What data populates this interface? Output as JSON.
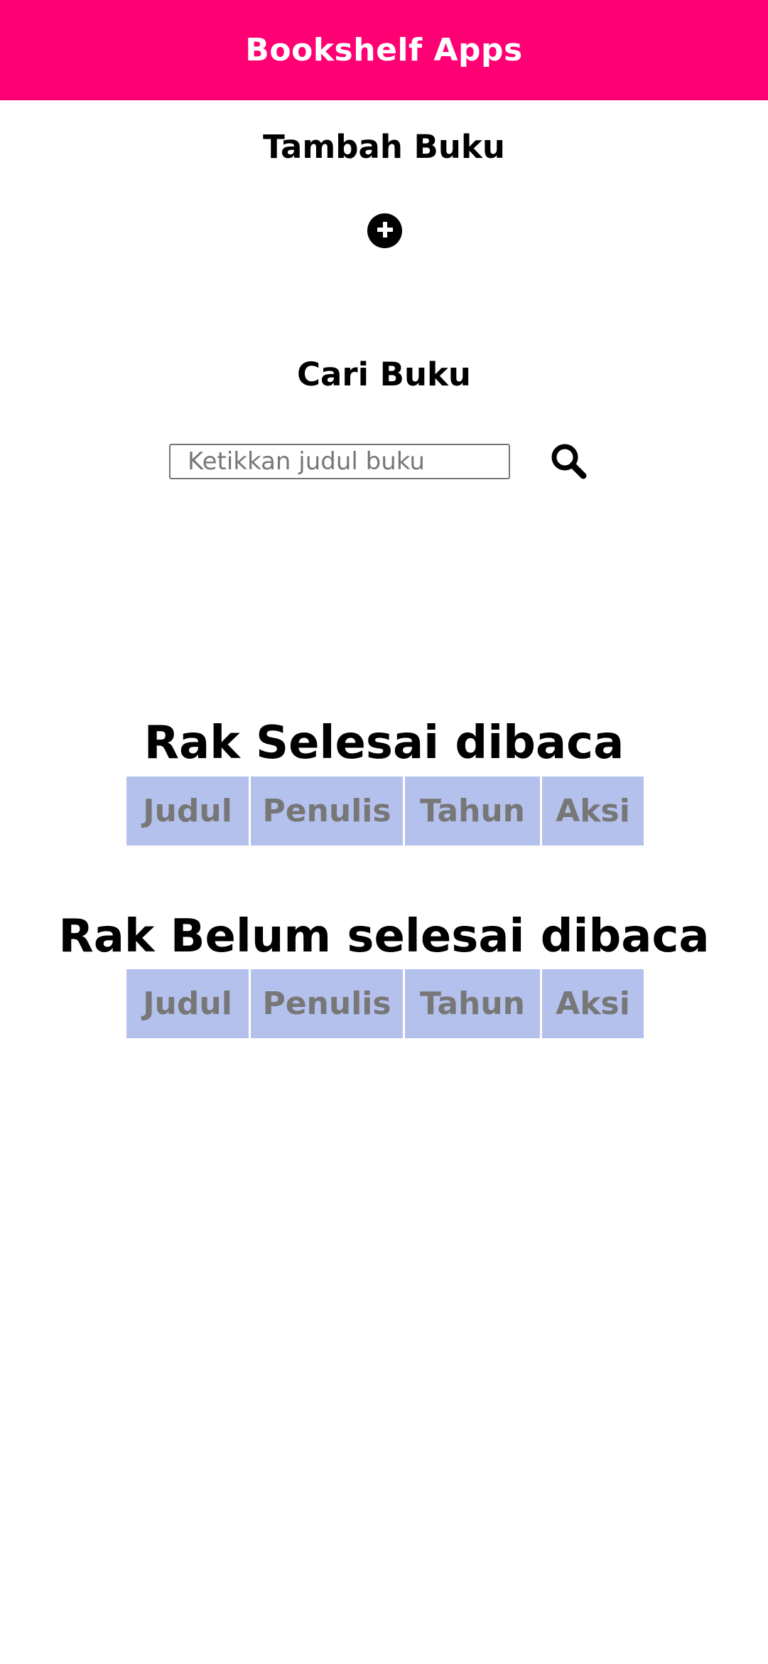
{
  "colors": {
    "header_bg": "#ff0074",
    "table_header_bg": "#b5c1ed",
    "table_header_text": "#777777"
  },
  "header": {
    "title": "Bookshelf Apps"
  },
  "add_section": {
    "title": "Tambah Buku",
    "button_icon": "plus-circle-icon"
  },
  "search_section": {
    "title": "Cari Buku",
    "placeholder": "Ketikkan judul buku",
    "value": "",
    "button_icon": "search-icon"
  },
  "shelves": [
    {
      "title": "Rak Selesai dibaca",
      "columns": [
        "Judul",
        "Penulis",
        "Tahun",
        "Aksi"
      ]
    },
    {
      "title": "Rak Belum selesai dibaca",
      "columns": [
        "Judul",
        "Penulis",
        "Tahun",
        "Aksi"
      ]
    }
  ]
}
